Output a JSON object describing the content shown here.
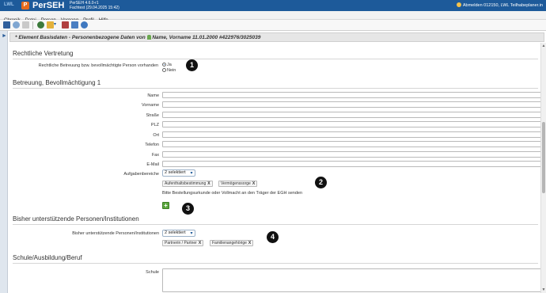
{
  "titlebar": {
    "brand_small": "LWL",
    "app_name": "PerSEH",
    "version_line1": "PerSEH 4.6.0-r1",
    "version_line2": "Fachtest (29.04.2025 15:42)",
    "user_text": "Abmelden 012150, LWL Teilhabeplaner.in"
  },
  "menu": [
    "Chronik",
    "Datei",
    "Person",
    "Vorgang",
    "Profil",
    "Hilfe"
  ],
  "header": {
    "text_prefix": "* Element Basisdaten - Personenbezogene Daten von",
    "text_suffix": "Name, Vorname 11.01.2000 #422976/3025039"
  },
  "rechtliche_vertretung": {
    "title": "Rechtliche Vertretung",
    "question_label": "Rechtliche Betreuung bzw. bevollmächtigte Person vorhanden",
    "option_yes": "Ja",
    "option_no": "Nein",
    "selected": "Ja"
  },
  "betreuung": {
    "title": "Betreuung, Bevollmächtigung 1",
    "fields": [
      {
        "label": "Name",
        "value": ""
      },
      {
        "label": "Vorname",
        "value": ""
      },
      {
        "label": "Straße",
        "value": ""
      },
      {
        "label": "PLZ",
        "value": ""
      },
      {
        "label": "Ort",
        "value": ""
      },
      {
        "label": "Telefon",
        "value": ""
      },
      {
        "label": "Fax",
        "value": ""
      },
      {
        "label": "E-Mail",
        "value": ""
      }
    ],
    "aufgaben_label": "Aufgabenbereiche",
    "aufgaben_select": "2 selektiert",
    "aufgaben_tags": [
      "Aufenthaltsbestimmung",
      "Vermögenssorge"
    ],
    "tag_remove": "X",
    "note": "Bitte Bestellungsurkunde oder Vollmacht an den Träger der EGH senden",
    "add_symbol": "+"
  },
  "unterstuetzende": {
    "title": "Bisher unterstützende Personen/Institutionen",
    "label": "Bisher unterstützende Personen/Institutionen",
    "select": "2 selektiert",
    "tags": [
      "Partnerin / Partner",
      "Familienangehörige"
    ]
  },
  "schule": {
    "title": "Schule/Ausbildung/Beruf",
    "label": "Schule",
    "value": ""
  },
  "badges": [
    "1",
    "2",
    "3",
    "4"
  ],
  "colors": {
    "titlebar": "#1d5a9a",
    "add_button": "#5aa53c",
    "badge": "#111111"
  }
}
